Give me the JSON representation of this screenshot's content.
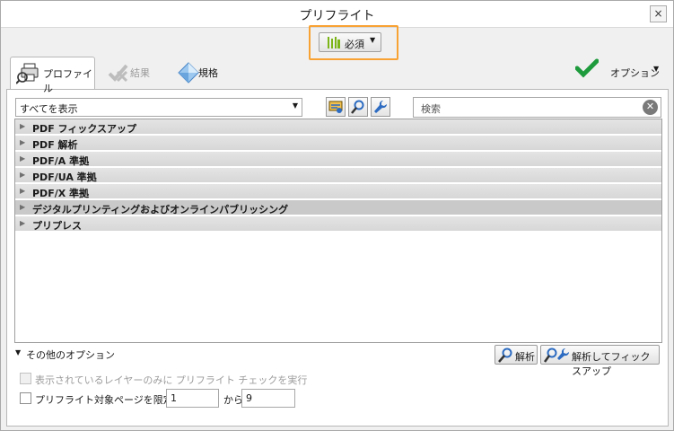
{
  "window": {
    "title": "プリフライト",
    "close_glyph": "×"
  },
  "required": {
    "label": "必須",
    "caret": "▼"
  },
  "tabs": [
    {
      "label": "プロファイル",
      "icon": "profile-icon",
      "active": true
    },
    {
      "label": "結果",
      "icon": "results-icon",
      "disabled": true
    },
    {
      "label": "規格",
      "icon": "standards-icon"
    }
  ],
  "options": {
    "label": "オプション",
    "caret": "▼"
  },
  "filter": {
    "value": "すべてを表示",
    "caret": "▼"
  },
  "search": {
    "placeholder": "検索",
    "clear_glyph": "✕"
  },
  "tree": {
    "arrow": "▶",
    "items": [
      "PDF フィックスアップ",
      "PDF 解析",
      "PDF/A 準拠",
      "PDF/UA 準拠",
      "PDF/X 準拠",
      "デジタルプリンティングおよびオンラインパブリッシング",
      "プリプレス"
    ]
  },
  "more_options": {
    "label": "その他のオプション",
    "caret": "▼"
  },
  "buttons": {
    "analyze": "解析",
    "analyze_fix": "解析してフィックスアップ"
  },
  "visible_layers": {
    "label": "表示されているレイヤーのみに プリフライト チェックを実行"
  },
  "page_range": {
    "label": "プリフライト対象ページを限定：",
    "from": "1",
    "to_label": "から",
    "to": "9"
  },
  "colors": {
    "accent_orange": "#f7a233",
    "check_green": "#1e9b3c",
    "tool_blue": "#2c6bc1"
  }
}
